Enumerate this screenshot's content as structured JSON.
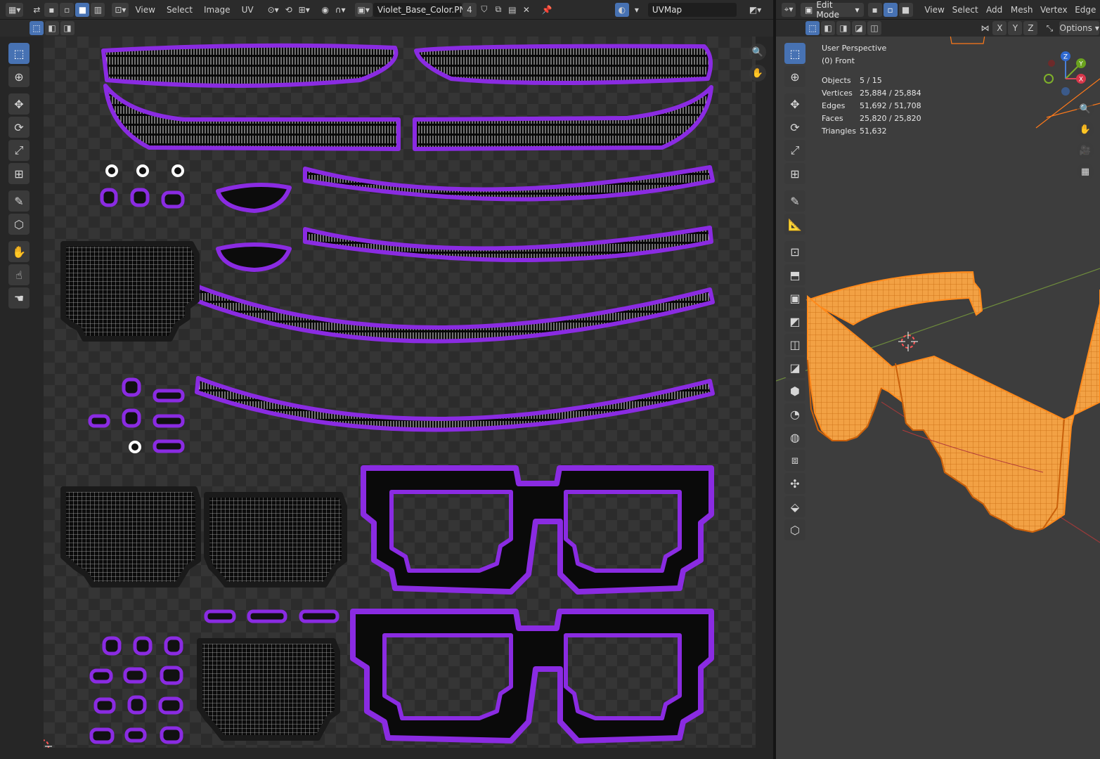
{
  "uv_editor": {
    "header": {
      "menus": [
        "View",
        "Select",
        "Image",
        "UV"
      ],
      "image_name": "Violet_Base_Color.PNG",
      "users": "4",
      "uv_map": "UVMap"
    }
  },
  "viewport": {
    "header": {
      "mode": "Edit Mode",
      "menus": [
        "View",
        "Select",
        "Add",
        "Mesh",
        "Vertex",
        "Edge"
      ],
      "axes": [
        "X",
        "Y",
        "Z"
      ],
      "options_label": "Options"
    },
    "overlay": {
      "title": "User Perspective",
      "subtitle": "(0) Front",
      "stats": [
        {
          "label": "Objects",
          "value": "5 / 15"
        },
        {
          "label": "Vertices",
          "value": "25,884 / 25,884"
        },
        {
          "label": "Edges",
          "value": "51,692 / 51,708"
        },
        {
          "label": "Faces",
          "value": "25,820 / 25,820"
        },
        {
          "label": "Triangles",
          "value": "51,632"
        }
      ]
    },
    "gizmo_axes": [
      "Z",
      "Y",
      "X"
    ]
  },
  "colors": {
    "uv_purple": "#8a2be2",
    "selection_orange": "#ff8a1c",
    "active_blue": "#4772b3"
  }
}
